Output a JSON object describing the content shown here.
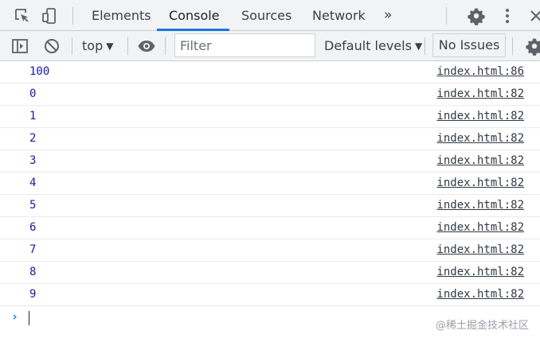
{
  "tabs": [
    {
      "label": "Elements"
    },
    {
      "label": "Console"
    },
    {
      "label": "Sources"
    },
    {
      "label": "Network"
    }
  ],
  "active_tab": "Console",
  "more_tabs_icon": "chevron-double-right-icon",
  "toolbar": {
    "context": "top",
    "filter_placeholder": "Filter",
    "levels": "Default levels",
    "issues": "No Issues"
  },
  "messages": [
    {
      "value": "100",
      "source": "index.html:86"
    },
    {
      "value": "0",
      "source": "index.html:82"
    },
    {
      "value": "1",
      "source": "index.html:82"
    },
    {
      "value": "2",
      "source": "index.html:82"
    },
    {
      "value": "3",
      "source": "index.html:82"
    },
    {
      "value": "4",
      "source": "index.html:82"
    },
    {
      "value": "5",
      "source": "index.html:82"
    },
    {
      "value": "6",
      "source": "index.html:82"
    },
    {
      "value": "7",
      "source": "index.html:82"
    },
    {
      "value": "8",
      "source": "index.html:82"
    },
    {
      "value": "9",
      "source": "index.html:82"
    }
  ],
  "prompt_symbol": "›",
  "watermark": "@稀土掘金技术社区",
  "colors": {
    "accent": "#1a73e8",
    "number_value": "#1a1aa6",
    "toolbar_bg": "#f1f3f4"
  }
}
